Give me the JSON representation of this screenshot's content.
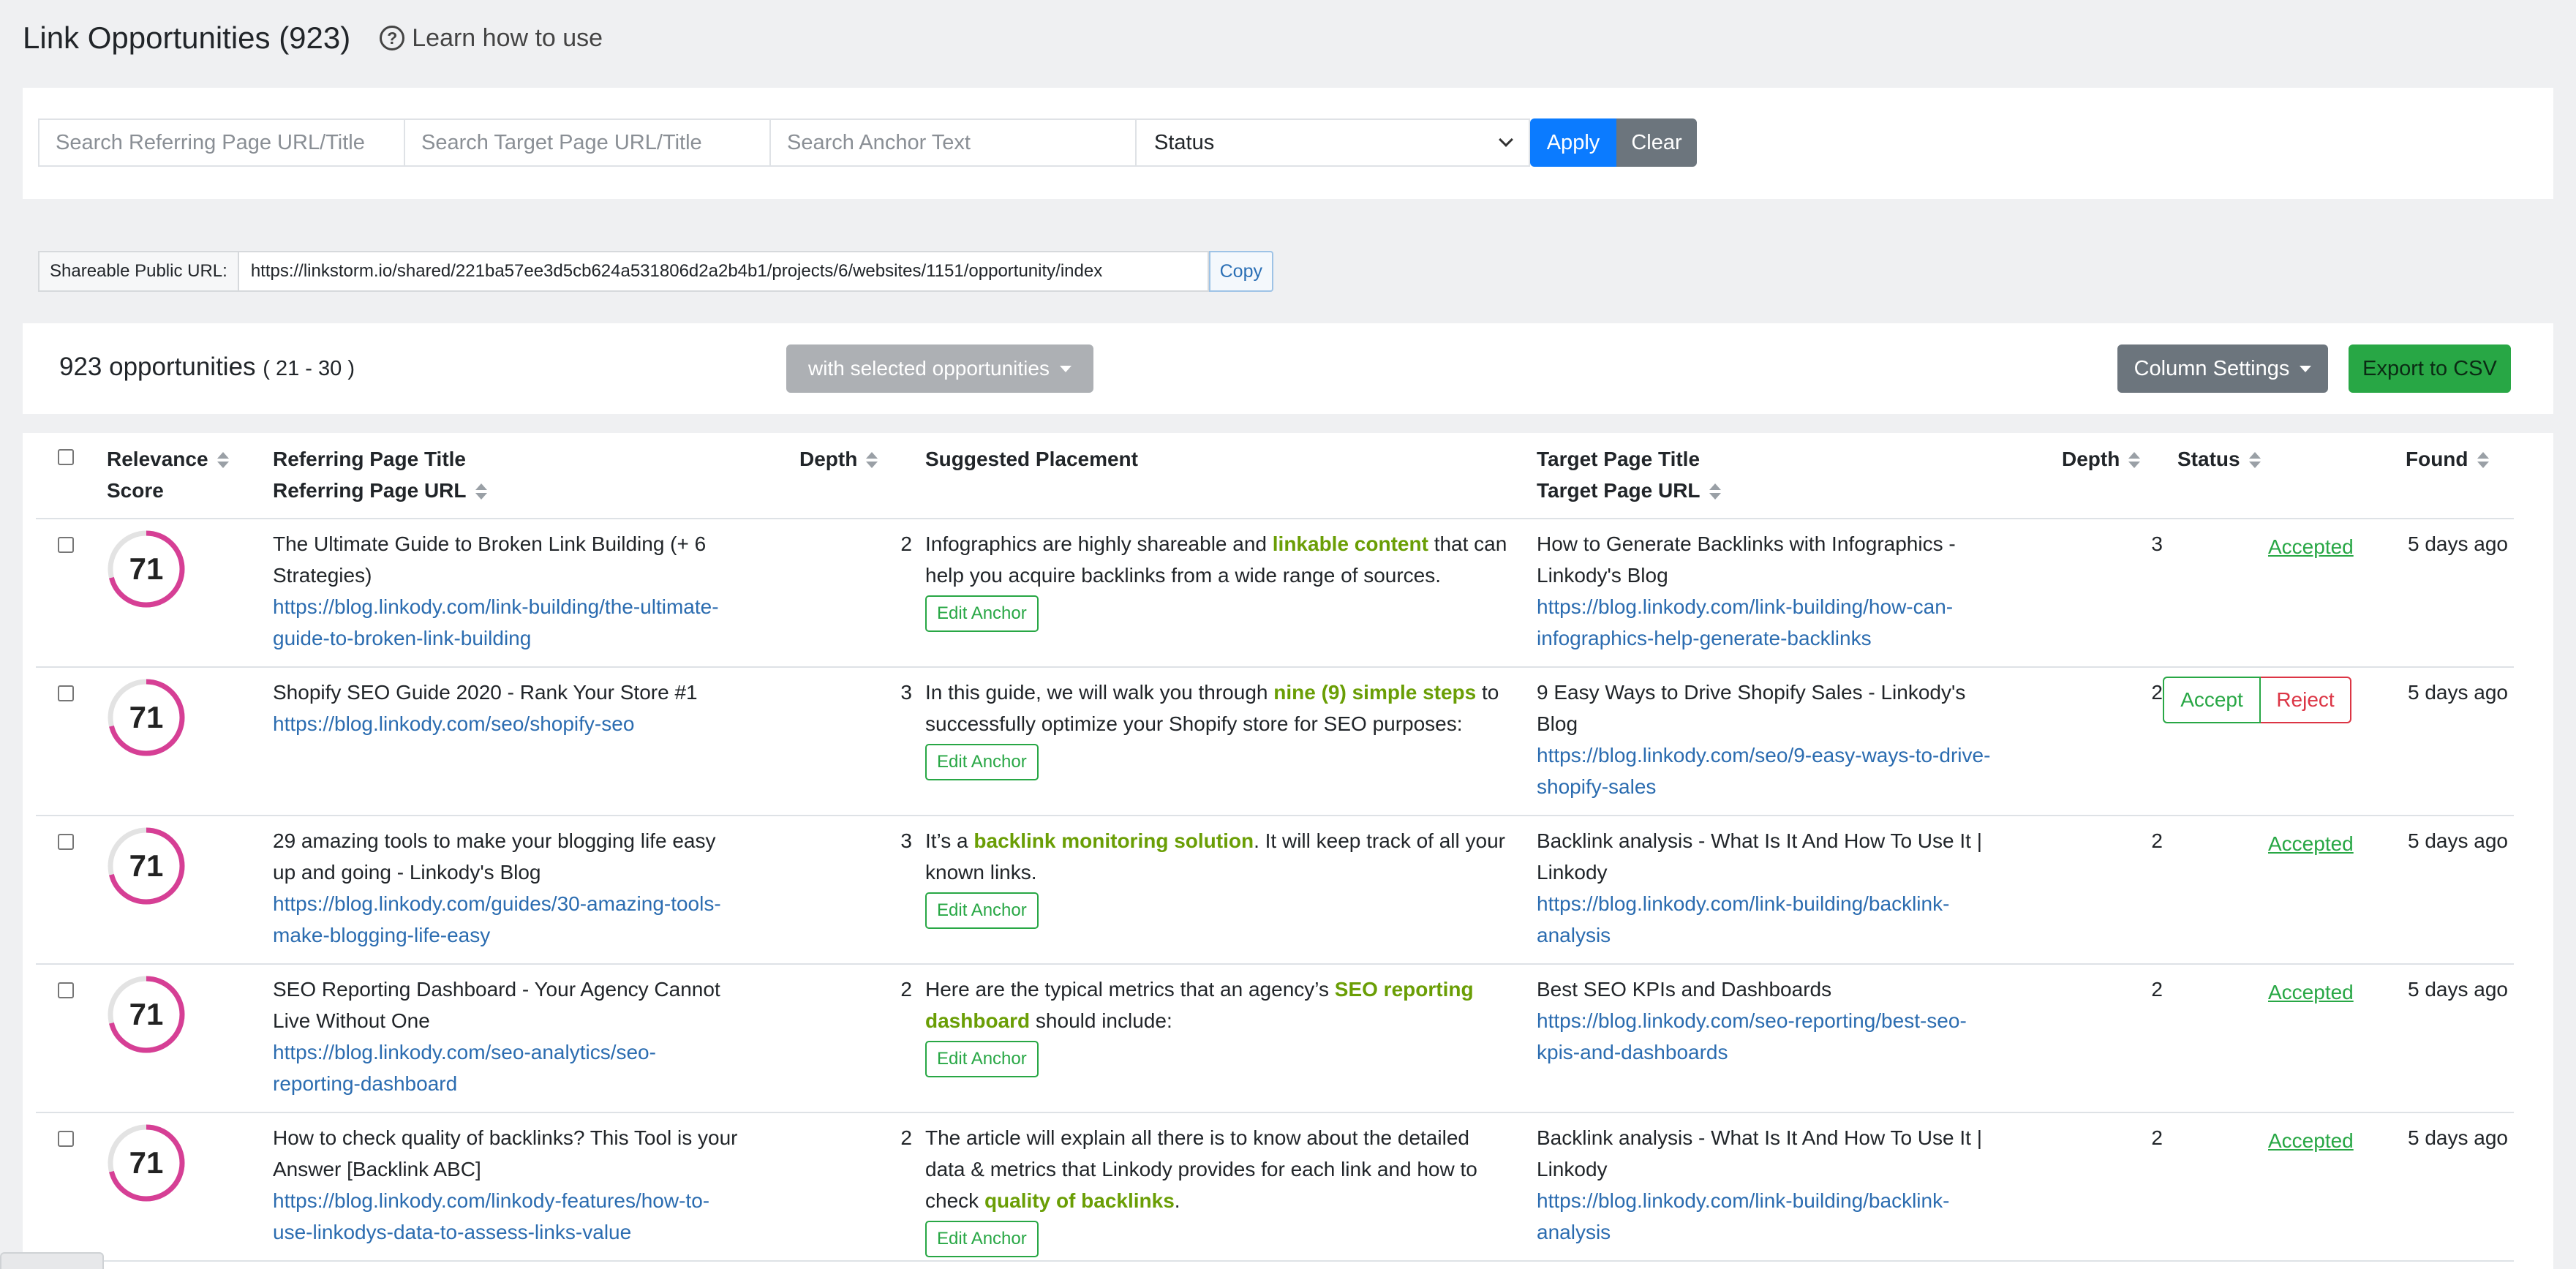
{
  "header": {
    "title": "Link Opportunities (923)",
    "learn_label": "Learn how to use"
  },
  "filters": {
    "referring_placeholder": "Search Referring Page URL/Title",
    "target_placeholder": "Search Target Page URL/Title",
    "anchor_placeholder": "Search Anchor Text",
    "status_selected": "Status",
    "apply_label": "Apply",
    "clear_label": "Clear"
  },
  "share": {
    "label": "Shareable Public URL:",
    "url": "https://linkstorm.io/shared/221ba57ee3d5cb624a531806d2a2b4b1/projects/6/websites/1151/opportunity/index",
    "copy_label": "Copy"
  },
  "summary": {
    "count": "923 opportunities",
    "range": "( 21 - 30 )",
    "with_selected_label": "with selected opportunities",
    "column_settings_label": "Column Settings",
    "export_label": "Export to CSV"
  },
  "columns": {
    "relevance_1": "Relevance",
    "relevance_2": "Score",
    "ref_title": "Referring Page Title",
    "ref_url": "Referring Page URL",
    "depth": "Depth",
    "suggested": "Suggested Placement",
    "tgt_title": "Target Page Title",
    "tgt_url": "Target Page URL",
    "depth2": "Depth",
    "status": "Status",
    "found": "Found"
  },
  "colors": {
    "accent_blue": "#0b7bff",
    "accepted_green": "#28a745",
    "reject_red": "#dc3545",
    "score_ring": "#d63f95"
  },
  "rows": [
    {
      "score": "71",
      "ref_title": "The Ultimate Guide to Broken Link Building (+ 6 Strategies)",
      "ref_url": "https://blog.linkody.com/link-building/the-ultimate-guide-to-broken-link-building",
      "ref_depth": "2",
      "sugg_before": "Infographics are highly shareable and ",
      "sugg_anchor": "linkable content",
      "sugg_after": " that can help you acquire backlinks from a wide range of sources.",
      "edit_label": "Edit Anchor",
      "tgt_title": "How to Generate Backlinks with Infographics - Linkody's Blog",
      "tgt_url": "https://blog.linkody.com/link-building/how-can-infographics-help-generate-backlinks",
      "tgt_depth": "3",
      "status": "Accepted",
      "found": "5 days ago"
    },
    {
      "score": "71",
      "ref_title": "Shopify SEO Guide 2020 - Rank Your Store #1",
      "ref_url": "https://blog.linkody.com/seo/shopify-seo",
      "ref_depth": "3",
      "sugg_before": "In this guide, we will walk you through ",
      "sugg_anchor": "nine (9) simple steps",
      "sugg_after": " to successfully optimize your Shopify store for SEO purposes:",
      "edit_label": "Edit Anchor",
      "tgt_title": "9 Easy Ways to Drive Shopify Sales - Linkody's Blog",
      "tgt_url": "https://blog.linkody.com/seo/9-easy-ways-to-drive-shopify-sales",
      "tgt_depth": "2",
      "accept_label": "Accept",
      "reject_label": "Reject",
      "found": "5 days ago"
    },
    {
      "score": "71",
      "ref_title": "29 amazing tools to make your blogging life easy up and going - Linkody's Blog",
      "ref_url": "https://blog.linkody.com/guides/30-amazing-tools-make-blogging-life-easy",
      "ref_depth": "3",
      "sugg_before": "It’s a ",
      "sugg_anchor": "backlink monitoring solution",
      "sugg_after": ". It will keep track of all your known links.",
      "edit_label": "Edit Anchor",
      "tgt_title": "Backlink analysis - What Is It And How To Use It | Linkody",
      "tgt_url": "https://blog.linkody.com/link-building/backlink-analysis",
      "tgt_depth": "2",
      "status": "Accepted",
      "found": "5 days ago"
    },
    {
      "score": "71",
      "ref_title": "SEO Reporting Dashboard - Your Agency Cannot Live Without One",
      "ref_url": "https://blog.linkody.com/seo-analytics/seo-reporting-dashboard",
      "ref_depth": "2",
      "sugg_before": "Here are the typical metrics that an agency’s ",
      "sugg_anchor": "SEO reporting dashboard",
      "sugg_after": " should include:",
      "edit_label": "Edit Anchor",
      "tgt_title": "Best SEO KPIs and Dashboards",
      "tgt_url": "https://blog.linkody.com/seo-reporting/best-seo-kpis-and-dashboards",
      "tgt_depth": "2",
      "status": "Accepted",
      "found": "5 days ago"
    },
    {
      "score": "71",
      "ref_title": "How to check quality of backlinks? This Tool is your Answer [Backlink ABC]",
      "ref_url": "https://blog.linkody.com/linkody-features/how-to-use-linkodys-data-to-assess-links-value",
      "ref_depth": "2",
      "sugg_before": "The article will explain all there is to know about the detailed data & metrics that Linkody provides for each link and how to check ",
      "sugg_anchor": "quality of backlinks",
      "sugg_after": ".",
      "edit_label": "Edit Anchor",
      "tgt_title": "Backlink analysis - What Is It And How To Use It | Linkody",
      "tgt_url": "https://blog.linkody.com/link-building/backlink-analysis",
      "tgt_depth": "2",
      "status": "Accepted",
      "found": "5 days ago"
    }
  ]
}
